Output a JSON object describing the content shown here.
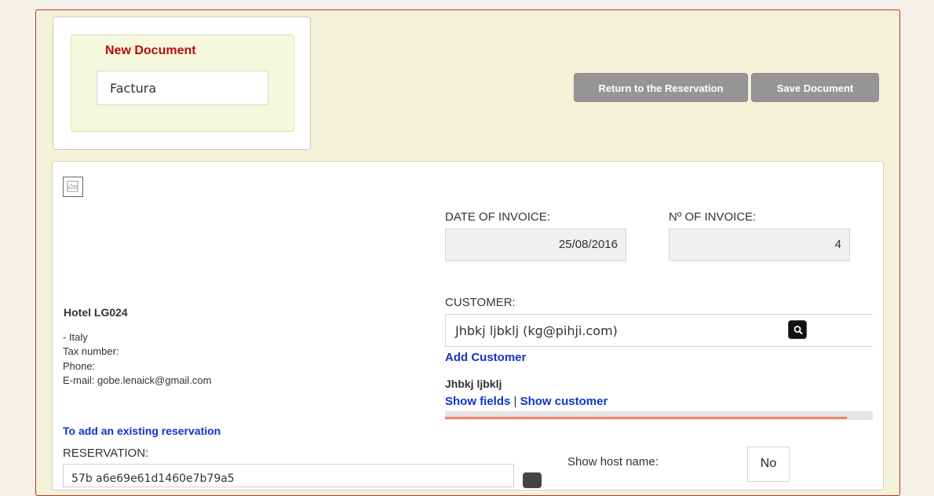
{
  "document": {
    "title": "New Document",
    "type_value": "Factura"
  },
  "actions": {
    "return_label": "Return to the Reservation",
    "save_label": "Save Document"
  },
  "invoice": {
    "date_label": "DATE OF INVOICE:",
    "date_value": "25/08/2016",
    "number_label": "Nº OF INVOICE:",
    "number_value": "4"
  },
  "hotel": {
    "name": "Hotel LG024",
    "country": "- Italy",
    "tax": "Tax number:",
    "phone": "Phone:",
    "email": "E-mail: gobe.lenaick@gmail.com"
  },
  "customer": {
    "label": "CUSTOMER:",
    "value": "Jhbkj ljbklj (kg@pihji.com)",
    "add_label": "Add Customer",
    "name": "Jhbkj ljbklj",
    "show_fields": "Show fields",
    "separator": "|",
    "show_customer": "Show customer",
    "progress": 0.94
  },
  "reservation": {
    "add_link": "To add an existing reservation",
    "label": "RESERVATION:",
    "value": "57b a6e69e61d1460e7b79a5",
    "show_host_label": "Show host name:",
    "show_host_value": "No"
  },
  "colors": {
    "accent_red": "#b40c0c",
    "link_blue": "#1232c8",
    "button_gray": "#959595",
    "progress": "#e88969"
  }
}
